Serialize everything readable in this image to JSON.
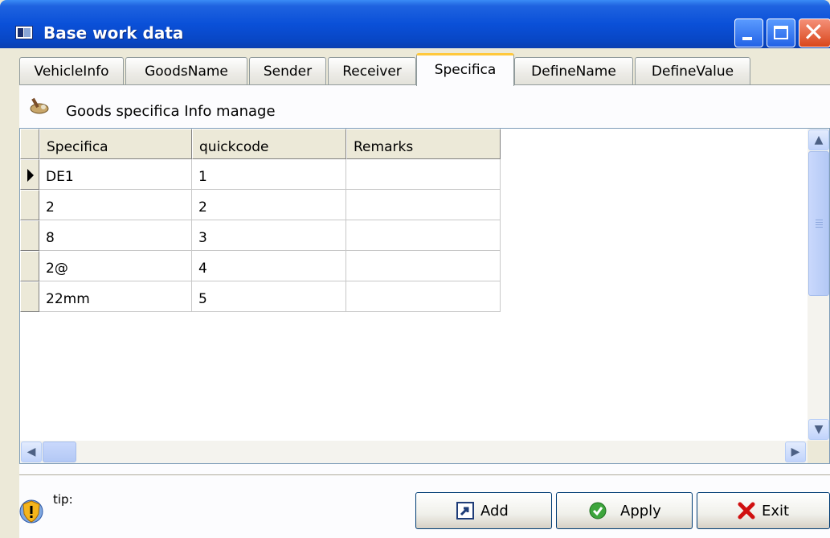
{
  "window": {
    "title": "Base work data"
  },
  "tabs": [
    {
      "label": "VehicleInfo"
    },
    {
      "label": "GoodsName"
    },
    {
      "label": "Sender"
    },
    {
      "label": "Receiver"
    },
    {
      "label": "Specifica",
      "active": true
    },
    {
      "label": "DefineName"
    },
    {
      "label": "DefineValue"
    }
  ],
  "panel": {
    "title": "Goods specifica Info manage"
  },
  "grid": {
    "columns": [
      "Specifica",
      "quickcode",
      "Remarks"
    ],
    "rows": [
      [
        "DE1",
        "1",
        ""
      ],
      [
        "2",
        "2",
        ""
      ],
      [
        "8",
        "3",
        ""
      ],
      [
        "2@",
        "4",
        ""
      ],
      [
        "22mm",
        "5",
        ""
      ]
    ],
    "selected_row": 0
  },
  "footer": {
    "tip_label": "tip:",
    "buttons": {
      "add": "Add",
      "apply": "Apply",
      "exit": "Exit"
    }
  },
  "colors": {
    "titlebar": "#0A50D8",
    "tab_highlight": "#FFC83C",
    "face": "#ECE9D8"
  }
}
